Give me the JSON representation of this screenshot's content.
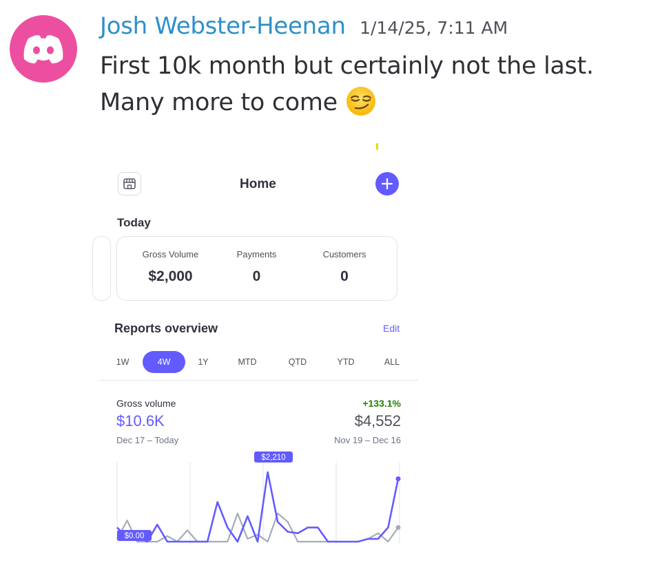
{
  "message": {
    "author": "Josh Webster-Heenan",
    "timestamp": "1/14/25, 7:11 AM",
    "text": "First 10k month but certainly not the last. Many more to come",
    "avatar_icon": "discord-logo-icon",
    "avatar_color": "#ec4fa0",
    "emoji": "smirking-face-emoji"
  },
  "app": {
    "title": "Home",
    "store_icon": "storefront-icon",
    "add_icon": "plus-icon",
    "accent": "#635bff",
    "today": {
      "heading": "Today",
      "stats": [
        {
          "label": "Gross Volume",
          "value": "$2,000"
        },
        {
          "label": "Payments",
          "value": "0"
        },
        {
          "label": "Customers",
          "value": "0"
        }
      ]
    },
    "reports": {
      "heading": "Reports overview",
      "edit_label": "Edit",
      "tabs": [
        "1W",
        "4W",
        "1Y",
        "MTD",
        "QTD",
        "YTD",
        "ALL"
      ],
      "active_tab": "4W",
      "gross_volume": {
        "label": "Gross volume",
        "value": "$10.6K",
        "range": "Dec 17 – Today",
        "change": "+133.1%",
        "previous_value": "$4,552",
        "previous_range": "Nov 19 – Dec 16"
      }
    }
  },
  "chart_data": {
    "type": "line",
    "max_label": "$2,210",
    "min_label": "$0.00",
    "ylim": [
      0,
      2210
    ],
    "grid": true,
    "series": [
      {
        "color": "#635bff",
        "values": [
          450,
          120,
          180,
          0,
          540,
          0,
          0,
          0,
          0,
          0,
          1260,
          450,
          0,
          810,
          0,
          2210,
          630,
          315,
          270,
          450,
          450,
          0,
          0,
          0,
          0,
          90,
          90,
          450,
          2000
        ]
      },
      {
        "color": "#a3acb9",
        "values": [
          90,
          675,
          0,
          0,
          0,
          180,
          0,
          360,
          0,
          0,
          0,
          0,
          900,
          90,
          225,
          0,
          900,
          630,
          0,
          0,
          0,
          0,
          0,
          0,
          0,
          90,
          270,
          0,
          450
        ]
      }
    ]
  }
}
